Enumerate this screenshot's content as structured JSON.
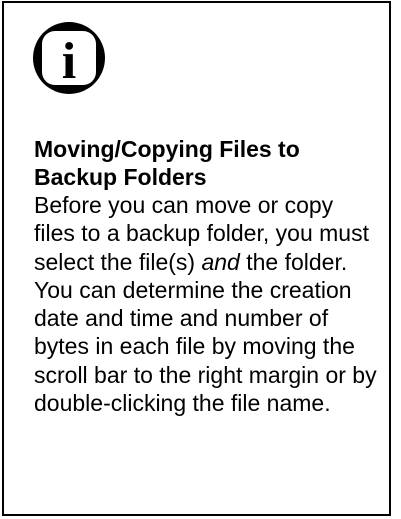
{
  "note": {
    "icon": "info-icon",
    "icon_glyph": "i",
    "heading": "Moving/Copying Files to Backup Folders",
    "body_before_em": "Before you can move or copy files to a backup folder, you must select the file(s) ",
    "body_em": "and",
    "body_after_em": " the folder. You can determine the creation date and time and number of bytes in each file by moving the scroll bar to the right margin or by double-clicking the file name."
  }
}
